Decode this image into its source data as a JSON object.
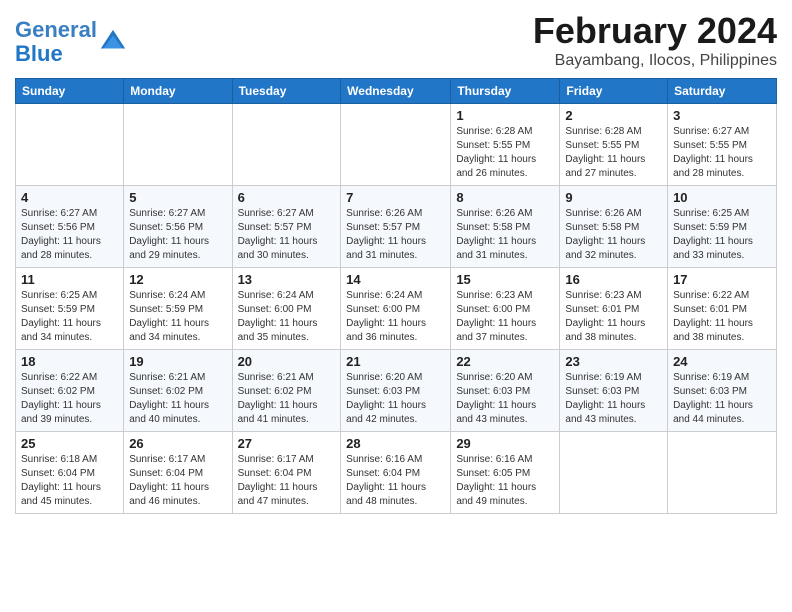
{
  "header": {
    "logo_line1": "General",
    "logo_line2": "Blue",
    "month": "February 2024",
    "location": "Bayambang, Ilocos, Philippines"
  },
  "weekdays": [
    "Sunday",
    "Monday",
    "Tuesday",
    "Wednesday",
    "Thursday",
    "Friday",
    "Saturday"
  ],
  "weeks": [
    [
      {
        "day": "",
        "info": ""
      },
      {
        "day": "",
        "info": ""
      },
      {
        "day": "",
        "info": ""
      },
      {
        "day": "",
        "info": ""
      },
      {
        "day": "1",
        "info": "Sunrise: 6:28 AM\nSunset: 5:55 PM\nDaylight: 11 hours and 26 minutes."
      },
      {
        "day": "2",
        "info": "Sunrise: 6:28 AM\nSunset: 5:55 PM\nDaylight: 11 hours and 27 minutes."
      },
      {
        "day": "3",
        "info": "Sunrise: 6:27 AM\nSunset: 5:55 PM\nDaylight: 11 hours and 28 minutes."
      }
    ],
    [
      {
        "day": "4",
        "info": "Sunrise: 6:27 AM\nSunset: 5:56 PM\nDaylight: 11 hours and 28 minutes."
      },
      {
        "day": "5",
        "info": "Sunrise: 6:27 AM\nSunset: 5:56 PM\nDaylight: 11 hours and 29 minutes."
      },
      {
        "day": "6",
        "info": "Sunrise: 6:27 AM\nSunset: 5:57 PM\nDaylight: 11 hours and 30 minutes."
      },
      {
        "day": "7",
        "info": "Sunrise: 6:26 AM\nSunset: 5:57 PM\nDaylight: 11 hours and 31 minutes."
      },
      {
        "day": "8",
        "info": "Sunrise: 6:26 AM\nSunset: 5:58 PM\nDaylight: 11 hours and 31 minutes."
      },
      {
        "day": "9",
        "info": "Sunrise: 6:26 AM\nSunset: 5:58 PM\nDaylight: 11 hours and 32 minutes."
      },
      {
        "day": "10",
        "info": "Sunrise: 6:25 AM\nSunset: 5:59 PM\nDaylight: 11 hours and 33 minutes."
      }
    ],
    [
      {
        "day": "11",
        "info": "Sunrise: 6:25 AM\nSunset: 5:59 PM\nDaylight: 11 hours and 34 minutes."
      },
      {
        "day": "12",
        "info": "Sunrise: 6:24 AM\nSunset: 5:59 PM\nDaylight: 11 hours and 34 minutes."
      },
      {
        "day": "13",
        "info": "Sunrise: 6:24 AM\nSunset: 6:00 PM\nDaylight: 11 hours and 35 minutes."
      },
      {
        "day": "14",
        "info": "Sunrise: 6:24 AM\nSunset: 6:00 PM\nDaylight: 11 hours and 36 minutes."
      },
      {
        "day": "15",
        "info": "Sunrise: 6:23 AM\nSunset: 6:00 PM\nDaylight: 11 hours and 37 minutes."
      },
      {
        "day": "16",
        "info": "Sunrise: 6:23 AM\nSunset: 6:01 PM\nDaylight: 11 hours and 38 minutes."
      },
      {
        "day": "17",
        "info": "Sunrise: 6:22 AM\nSunset: 6:01 PM\nDaylight: 11 hours and 38 minutes."
      }
    ],
    [
      {
        "day": "18",
        "info": "Sunrise: 6:22 AM\nSunset: 6:02 PM\nDaylight: 11 hours and 39 minutes."
      },
      {
        "day": "19",
        "info": "Sunrise: 6:21 AM\nSunset: 6:02 PM\nDaylight: 11 hours and 40 minutes."
      },
      {
        "day": "20",
        "info": "Sunrise: 6:21 AM\nSunset: 6:02 PM\nDaylight: 11 hours and 41 minutes."
      },
      {
        "day": "21",
        "info": "Sunrise: 6:20 AM\nSunset: 6:03 PM\nDaylight: 11 hours and 42 minutes."
      },
      {
        "day": "22",
        "info": "Sunrise: 6:20 AM\nSunset: 6:03 PM\nDaylight: 11 hours and 43 minutes."
      },
      {
        "day": "23",
        "info": "Sunrise: 6:19 AM\nSunset: 6:03 PM\nDaylight: 11 hours and 43 minutes."
      },
      {
        "day": "24",
        "info": "Sunrise: 6:19 AM\nSunset: 6:03 PM\nDaylight: 11 hours and 44 minutes."
      }
    ],
    [
      {
        "day": "25",
        "info": "Sunrise: 6:18 AM\nSunset: 6:04 PM\nDaylight: 11 hours and 45 minutes."
      },
      {
        "day": "26",
        "info": "Sunrise: 6:17 AM\nSunset: 6:04 PM\nDaylight: 11 hours and 46 minutes."
      },
      {
        "day": "27",
        "info": "Sunrise: 6:17 AM\nSunset: 6:04 PM\nDaylight: 11 hours and 47 minutes."
      },
      {
        "day": "28",
        "info": "Sunrise: 6:16 AM\nSunset: 6:04 PM\nDaylight: 11 hours and 48 minutes."
      },
      {
        "day": "29",
        "info": "Sunrise: 6:16 AM\nSunset: 6:05 PM\nDaylight: 11 hours and 49 minutes."
      },
      {
        "day": "",
        "info": ""
      },
      {
        "day": "",
        "info": ""
      }
    ]
  ]
}
